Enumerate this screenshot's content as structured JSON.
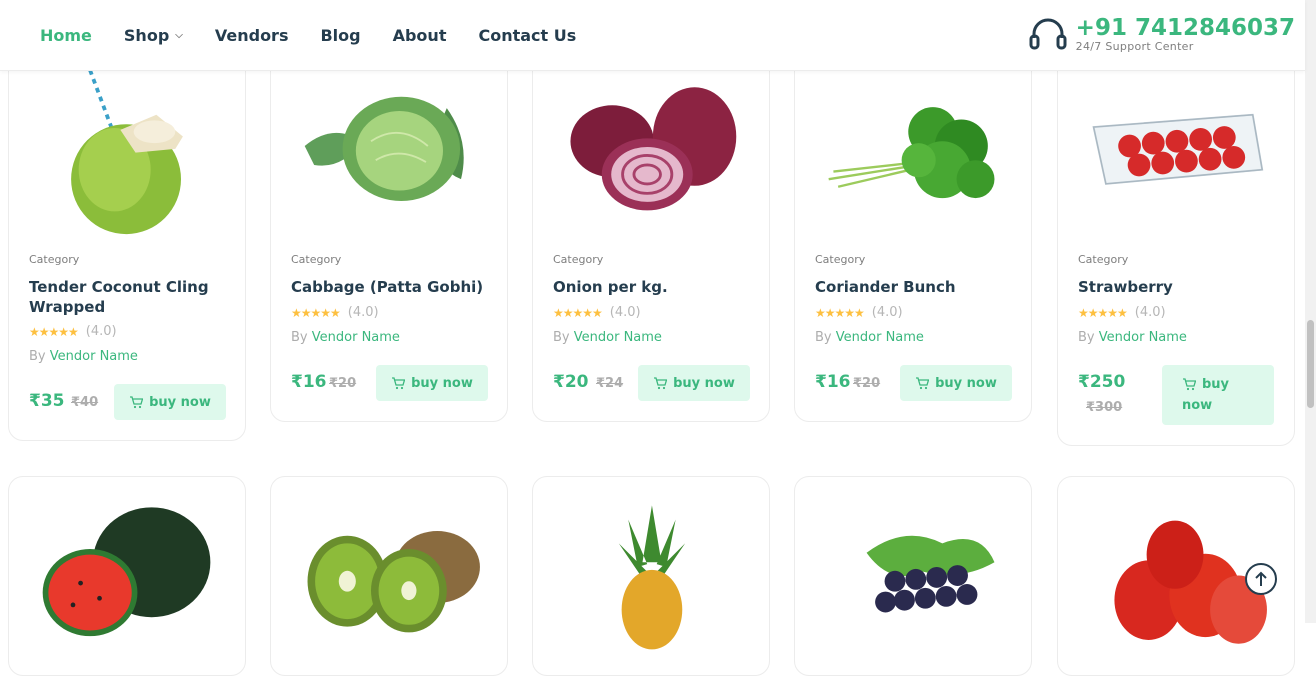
{
  "nav": {
    "items": [
      {
        "label": "Home",
        "active": true
      },
      {
        "label": "Shop",
        "has_dropdown": true
      },
      {
        "label": "Vendors"
      },
      {
        "label": "Blog"
      },
      {
        "label": "About"
      },
      {
        "label": "Contact Us"
      }
    ],
    "chevron": "⌵"
  },
  "support": {
    "icon": "headset-icon",
    "phone": "+91 7412846037",
    "subtitle": "24/7 Support Center"
  },
  "products": [
    {
      "category": "Category",
      "title": "Tender Coconut Cling Wrapped",
      "rating": "(4.0)",
      "vendor_prefix": "By",
      "vendor": "Vendor Name",
      "price": "₹35",
      "old_price": "₹40",
      "buy": "buy now"
    },
    {
      "category": "Category",
      "title": "Cabbage (Patta Gobhi)",
      "rating": "(4.0)",
      "vendor_prefix": "By",
      "vendor": "Vendor Name",
      "price": "₹16",
      "old_price": "₹20",
      "buy": "buy now"
    },
    {
      "category": "Category",
      "title": "Onion per kg.",
      "rating": "(4.0)",
      "vendor_prefix": "By",
      "vendor": "Vendor Name",
      "price": "₹20",
      "old_price": "₹24",
      "buy": "buy now"
    },
    {
      "category": "Category",
      "title": "Coriander Bunch",
      "rating": "(4.0)",
      "vendor_prefix": "By",
      "vendor": "Vendor Name",
      "price": "₹16",
      "old_price": "₹20",
      "buy": "buy now"
    },
    {
      "category": "Category",
      "title": "Strawberry",
      "rating": "(4.0)",
      "vendor_prefix": "By",
      "vendor": "Vendor Name",
      "price": "₹250",
      "old_price": "₹300",
      "buy_line1": "buy",
      "buy_line2": "now"
    }
  ],
  "second_row": [
    "watermelon",
    "kiwi",
    "pineapple",
    "grapes",
    "tomato"
  ],
  "stars": "★★★★★",
  "colors": {
    "brand": "#3bb77e",
    "text": "#253d4e",
    "muted": "#7e7e7e",
    "buy_bg": "#def9ec",
    "star": "#fdc040"
  }
}
